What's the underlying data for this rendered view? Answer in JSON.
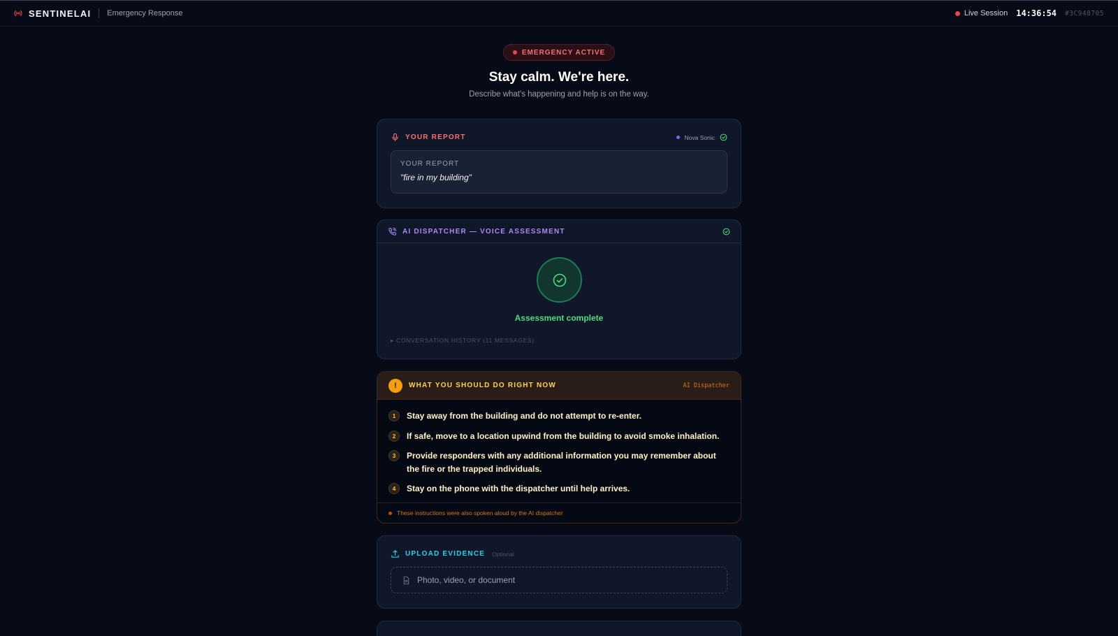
{
  "header": {
    "brand": "SENTINELAI",
    "subtitle": "Emergency Response",
    "live_label": "Live Session",
    "clock": "14:36:54",
    "session_id": "#3C948705"
  },
  "hero": {
    "status_pill": "EMERGENCY ACTIVE",
    "title": "Stay calm. We're here.",
    "subtitle": "Describe what's happening and help is on the way."
  },
  "report_card": {
    "title": "YOUR REPORT",
    "engine": "Nova Sonic",
    "box_label": "YOUR REPORT",
    "transcript": "\"fire in my building\""
  },
  "dispatcher_card": {
    "title": "AI DISPATCHER — VOICE ASSESSMENT",
    "status": "Assessment complete",
    "history_toggle": "▸ CONVERSATION HISTORY (11 MESSAGES)"
  },
  "instructions_card": {
    "title": "WHAT YOU SHOULD DO RIGHT NOW",
    "source": "AI Dispatcher",
    "steps": [
      {
        "num": "1",
        "text": "Stay away from the building and do not attempt to re-enter."
      },
      {
        "num": "2",
        "text": "If safe, move to a location upwind from the building to avoid smoke inhalation."
      },
      {
        "num": "3",
        "text": "Provide responders with any additional information you may remember about the fire or the trapped individuals."
      },
      {
        "num": "4",
        "text": "Stay on the phone with the dispatcher until help arrives."
      }
    ],
    "footer": "These instructions were also spoken aloud by the AI dispatcher"
  },
  "upload_card": {
    "title": "UPLOAD EVIDENCE",
    "optional": "Optional",
    "dropzone_placeholder": "Photo, video, or document"
  },
  "icons": {
    "brand": "broadcast-icon",
    "report": "microphone-icon",
    "dispatcher": "phone-icon",
    "ok": "check-circle-icon",
    "alert": "exclamation-icon",
    "upload": "upload-icon",
    "file": "document-icon"
  },
  "colors": {
    "background": "#070b17",
    "emergency_red": "#ef4444",
    "dispatcher_purple": "#a78bfa",
    "success_green": "#4ade80",
    "warning_amber": "#f59e0b",
    "upload_cyan": "#22d3ee"
  }
}
